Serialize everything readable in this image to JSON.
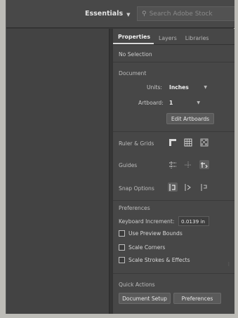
{
  "topbar": {
    "workspace_label": "Essentials",
    "search_placeholder": "Search Adobe Stock"
  },
  "panel": {
    "tabs": [
      {
        "label": "Properties",
        "active": true
      },
      {
        "label": "Layers",
        "active": false
      },
      {
        "label": "Libraries",
        "active": false
      }
    ],
    "selection_text": "No Selection",
    "document": {
      "section_label": "Document",
      "units_label": "Units:",
      "units_value": "Inches",
      "artboard_label": "Artboard:",
      "artboard_value": "1",
      "edit_artboards_label": "Edit Artboards"
    },
    "ruler_grids_label": "Ruler & Grids",
    "guides_label": "Guides",
    "snap_options_label": "Snap Options",
    "preferences": {
      "section_label": "Preferences",
      "keyboard_increment_label": "Keyboard Increment:",
      "keyboard_increment_value": "0.0139 in",
      "checkboxes": [
        {
          "label": "Use Preview Bounds",
          "checked": false
        },
        {
          "label": "Scale Corners",
          "checked": false
        },
        {
          "label": "Scale Strokes & Effects",
          "checked": false
        }
      ]
    },
    "quick_actions": {
      "section_label": "Quick Actions",
      "document_setup_label": "Document Setup",
      "preferences_label": "Preferences"
    }
  },
  "icons": {
    "ruler": "ruler-icon",
    "grid": "grid-icon",
    "transparency_grid": "transparency-grid-icon",
    "guides": "guides-icon",
    "smart_guides": "smart-guides-icon",
    "guides_lock": "lock-guides-icon",
    "snap_point": "snap-to-point-icon",
    "snap_pixel": "snap-to-pixel-icon",
    "snap_glyph": "snap-to-glyph-icon"
  },
  "colors": {
    "panel_bg": "#474747",
    "canvas_bg": "#434343",
    "topbar_bg": "#484848"
  }
}
